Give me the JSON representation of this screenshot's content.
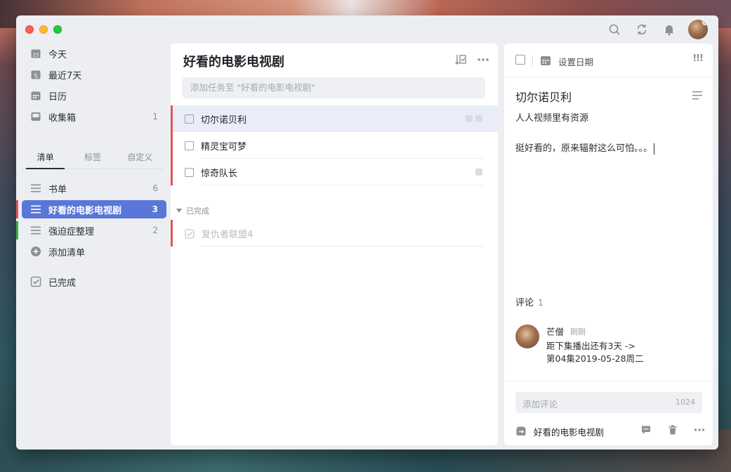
{
  "sidebar": {
    "smart": [
      {
        "label": "今天",
        "icon": "calendar-today-icon",
        "badge": "25"
      },
      {
        "label": "最近7天",
        "icon": "calendar-week-icon"
      },
      {
        "label": "日历",
        "icon": "calendar-icon"
      },
      {
        "label": "收集箱",
        "icon": "inbox-icon",
        "count": "1"
      }
    ],
    "tabs": [
      "清单",
      "标签",
      "自定义"
    ],
    "lists": [
      {
        "label": "书单",
        "count": "6",
        "color": ""
      },
      {
        "label": "好看的电影电视剧",
        "count": "3",
        "color": "#e2555b"
      },
      {
        "label": "强迫症整理",
        "count": "2",
        "color": "#3cab4a"
      }
    ],
    "add_list": "添加清单",
    "completed": "已完成"
  },
  "list": {
    "title": "好看的电影电视剧",
    "add_placeholder": "添加任务至 \"好看的电影电视剧\"",
    "tasks": [
      {
        "title": "切尔诺贝利"
      },
      {
        "title": "精灵宝可梦"
      },
      {
        "title": "惊奇队长"
      }
    ],
    "done_header": "已完成",
    "done_tasks": [
      {
        "title": "复仇者联盟4"
      }
    ]
  },
  "detail": {
    "set_date": "设置日期",
    "priority": "!!!",
    "title": "切尔诺贝利",
    "subtitle": "人人视频里有资源",
    "note": "挺好看的，原来辐射这么可怕。。。",
    "comments_label": "评论",
    "comments_count": "1",
    "comment": {
      "author": "芒僧",
      "time": "刚刚",
      "line1": "距下集播出还有3天 ->",
      "line2": "第04集2019-05-28周二"
    },
    "comment_placeholder": "添加评论",
    "comment_limit": "1024",
    "list_name": "好看的电影电视剧"
  },
  "colors": {
    "accent": "#5a76d8",
    "priority_red": "#e2555b",
    "green": "#3cab4a"
  }
}
